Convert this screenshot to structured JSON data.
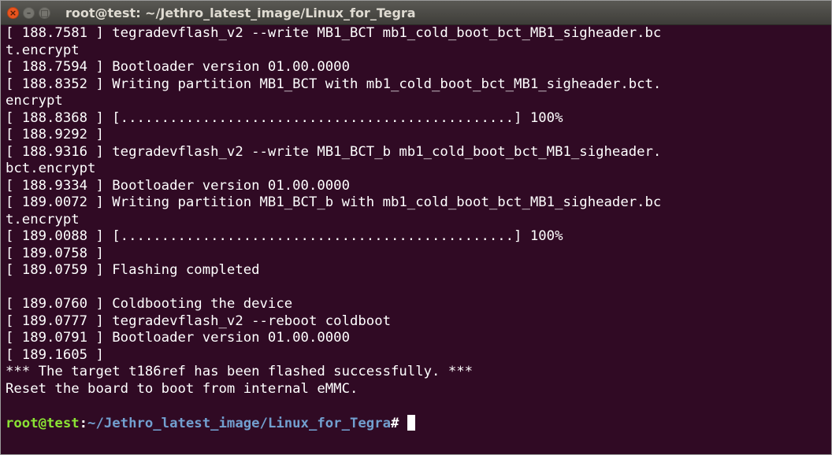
{
  "window": {
    "title": "root@test: ~/Jethro_latest_image/Linux_for_Tegra",
    "buttons": {
      "close": "×",
      "minimize": "–",
      "maximize": "□"
    }
  },
  "terminal": {
    "lines": [
      "[ 188.7581 ] tegradevflash_v2 --write MB1_BCT mb1_cold_boot_bct_MB1_sigheader.bc",
      "t.encrypt",
      "[ 188.7594 ] Bootloader version 01.00.0000",
      "[ 188.8352 ] Writing partition MB1_BCT with mb1_cold_boot_bct_MB1_sigheader.bct.",
      "encrypt",
      "[ 188.8368 ] [................................................] 100%",
      "[ 188.9292 ]",
      "[ 188.9316 ] tegradevflash_v2 --write MB1_BCT_b mb1_cold_boot_bct_MB1_sigheader.",
      "bct.encrypt",
      "[ 188.9334 ] Bootloader version 01.00.0000",
      "[ 189.0072 ] Writing partition MB1_BCT_b with mb1_cold_boot_bct_MB1_sigheader.bc",
      "t.encrypt",
      "[ 189.0088 ] [................................................] 100%",
      "[ 189.0758 ]",
      "[ 189.0759 ] Flashing completed",
      "",
      "[ 189.0760 ] Coldbooting the device",
      "[ 189.0777 ] tegradevflash_v2 --reboot coldboot",
      "[ 189.0791 ] Bootloader version 01.00.0000",
      "[ 189.1605 ]",
      "*** The target t186ref has been flashed successfully. ***",
      "Reset the board to boot from internal eMMC.",
      ""
    ],
    "prompt": {
      "user_host": "root@test",
      "separator": ":",
      "path": "~/Jethro_latest_image/Linux_for_Tegra",
      "symbol": "# "
    }
  },
  "colors": {
    "background": "#300a24",
    "titlebar": "#3e3d39",
    "text": "#ffffff",
    "prompt_user": "#8ae234",
    "prompt_path": "#729fcf",
    "close_button": "#e9541f"
  }
}
